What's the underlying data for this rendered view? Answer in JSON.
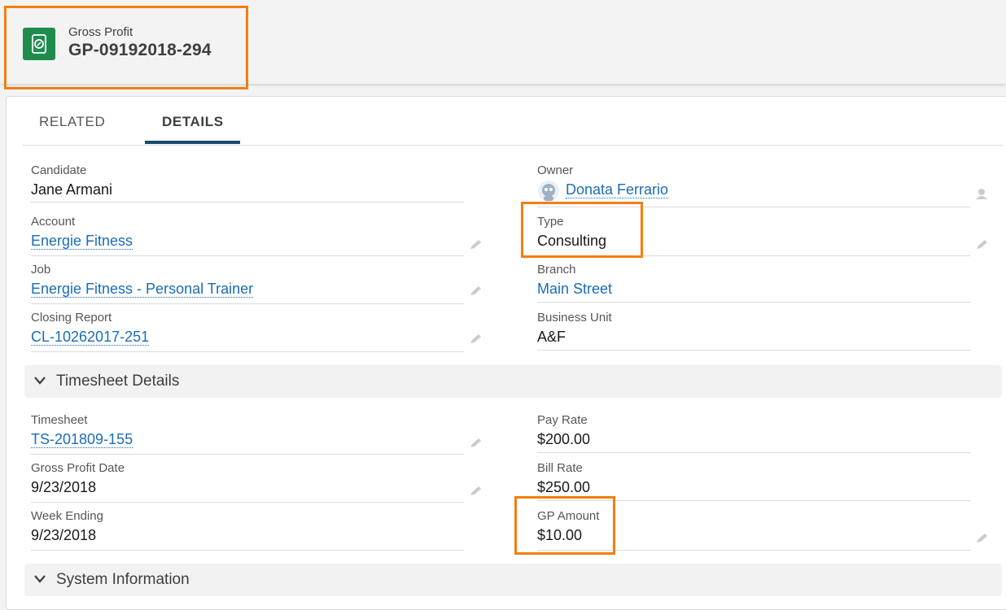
{
  "header": {
    "object_label": "Gross Profit",
    "record_name": "GP-09192018-294"
  },
  "tabs": [
    {
      "label": "RELATED"
    },
    {
      "label": "DETAILS"
    }
  ],
  "details": {
    "candidate": {
      "label": "Candidate",
      "value": "Jane Armani"
    },
    "owner": {
      "label": "Owner",
      "value": "Donata Ferrario"
    },
    "account": {
      "label": "Account",
      "value": "Energie Fitness"
    },
    "type": {
      "label": "Type",
      "value": "Consulting"
    },
    "job": {
      "label": "Job",
      "value": "Energie Fitness - Personal Trainer"
    },
    "branch": {
      "label": "Branch",
      "value": "Main Street"
    },
    "closing_report": {
      "label": "Closing Report",
      "value": "CL-10262017-251"
    },
    "business_unit": {
      "label": "Business Unit",
      "value": "A&F"
    }
  },
  "timesheet_section": {
    "title": "Timesheet Details",
    "timesheet": {
      "label": "Timesheet",
      "value": "TS-201809-155"
    },
    "pay_rate": {
      "label": "Pay Rate",
      "value": "$200.00"
    },
    "gross_profit_date": {
      "label": "Gross Profit Date",
      "value": "9/23/2018"
    },
    "bill_rate": {
      "label": "Bill Rate",
      "value": "$250.00"
    },
    "week_ending": {
      "label": "Week Ending",
      "value": "9/23/2018"
    },
    "gp_amount": {
      "label": "GP Amount",
      "value": "$10.00"
    }
  },
  "system_section": {
    "title": "System Information"
  },
  "colors": {
    "highlight": "#f47e0d",
    "link": "#1b6cb5",
    "header_icon": "#1f8c4e",
    "tab_active": "#1b4a6b"
  },
  "icons": [
    "gross-profit-icon",
    "edit-pencil-icon",
    "change-owner-icon",
    "chevron-down-icon",
    "owner-avatar-icon"
  ]
}
